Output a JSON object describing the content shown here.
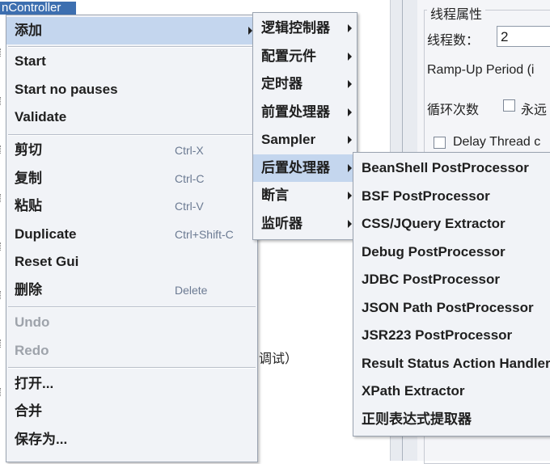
{
  "background": {
    "tree_selected_label": "nController",
    "partial_text": "调试）"
  },
  "thread_panel": {
    "group_title": "线程属性",
    "threads_label": "线程数：",
    "threads_value": "2",
    "rampup_label": "Ramp-Up Period (i",
    "loop_label": "循环次数",
    "forever_label": "永远",
    "delay_label": "Delay Thread c"
  },
  "context_menu": {
    "items": [
      {
        "label": "添加",
        "shortcut": ""
      },
      {
        "label": "Start",
        "shortcut": ""
      },
      {
        "label": "Start no pauses",
        "shortcut": ""
      },
      {
        "label": "Validate",
        "shortcut": ""
      },
      {
        "label": "剪切",
        "shortcut": "Ctrl-X"
      },
      {
        "label": "复制",
        "shortcut": "Ctrl-C"
      },
      {
        "label": "粘贴",
        "shortcut": "Ctrl-V"
      },
      {
        "label": "Duplicate",
        "shortcut": "Ctrl+Shift-C"
      },
      {
        "label": "Reset Gui",
        "shortcut": ""
      },
      {
        "label": "删除",
        "shortcut": "Delete"
      },
      {
        "label": "Undo",
        "shortcut": ""
      },
      {
        "label": "Redo",
        "shortcut": ""
      },
      {
        "label": "打开...",
        "shortcut": ""
      },
      {
        "label": "合并",
        "shortcut": ""
      },
      {
        "label": "保存为...",
        "shortcut": ""
      }
    ]
  },
  "add_submenu": {
    "items": [
      "逻辑控制器",
      "配置元件",
      "定时器",
      "前置处理器",
      "Sampler",
      "后置处理器",
      "断言",
      "监听器"
    ]
  },
  "post_processor_submenu": {
    "items": [
      "BeanShell PostProcessor",
      "BSF PostProcessor",
      "CSS/JQuery Extractor",
      "Debug PostProcessor",
      "JDBC PostProcessor",
      "JSON Path PostProcessor",
      "JSR223 PostProcessor",
      "Result Status Action Handler",
      "XPath Extractor",
      "正则表达式提取器"
    ]
  },
  "colors": {
    "highlight": "#c4d6ee",
    "menu_bg": "#f1f3f7",
    "shortcut": "#6b7a92",
    "tree_selected": "#3d6fb0"
  }
}
